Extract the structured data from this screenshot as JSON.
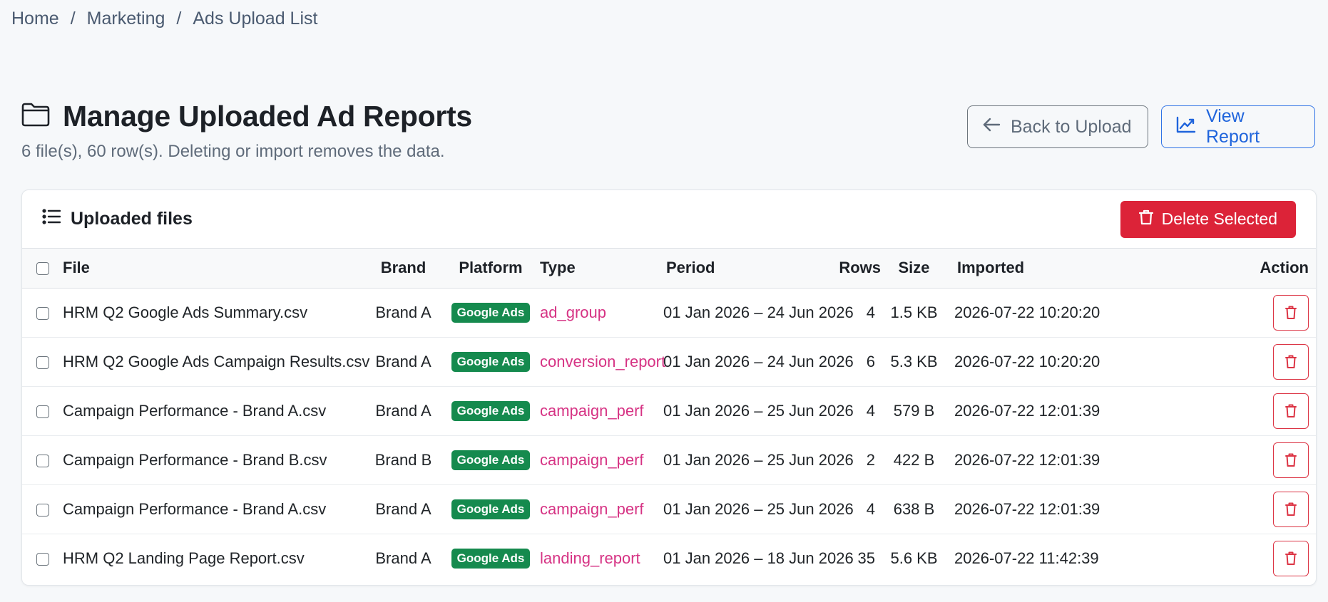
{
  "breadcrumb": {
    "items": [
      "Home",
      "Marketing",
      "Ads Upload List"
    ],
    "separator": "/"
  },
  "header": {
    "title": "Manage Uploaded Ad Reports",
    "subtitle": "6 file(s), 60 row(s). Deleting or import removes the data.",
    "icon": "folder-icon",
    "back_label": "Back to Upload",
    "view_label": "View Report"
  },
  "card": {
    "title": "Uploaded files",
    "delete_selected_label": "Delete Selected"
  },
  "table": {
    "columns": [
      "File",
      "Brand",
      "Platform",
      "Type",
      "Period",
      "Rows",
      "Size",
      "Imported",
      "Action"
    ],
    "rows": [
      {
        "file": "HRM Q2 Google Ads Summary.csv",
        "brand": "Brand A",
        "platform": "Google Ads",
        "type": "ad_group",
        "period": "01 Jan 2026 – 24 Jun 2026",
        "rows": "4",
        "size": "1.5 KB",
        "imported": "2026-07-22 10:20:20"
      },
      {
        "file": "HRM Q2 Google Ads Campaign Results.csv",
        "brand": "Brand A",
        "platform": "Google Ads",
        "type": "conversion_report",
        "period": "01 Jan 2026 – 24 Jun 2026",
        "rows": "6",
        "size": "5.3 KB",
        "imported": "2026-07-22 10:20:20"
      },
      {
        "file": "Campaign Performance - Brand A.csv",
        "brand": "Brand A",
        "platform": "Google Ads",
        "type": "campaign_perf",
        "period": "01 Jan 2026 – 25 Jun 2026",
        "rows": "4",
        "size": "579 B",
        "imported": "2026-07-22 12:01:39"
      },
      {
        "file": "Campaign Performance - Brand B.csv",
        "brand": "Brand B",
        "platform": "Google Ads",
        "type": "campaign_perf",
        "period": "01 Jan 2026 – 25 Jun 2026",
        "rows": "2",
        "size": "422 B",
        "imported": "2026-07-22 12:01:39"
      },
      {
        "file": "Campaign Performance - Brand A.csv",
        "brand": "Brand A",
        "platform": "Google Ads",
        "type": "campaign_perf",
        "period": "01 Jan 2026 – 25 Jun 2026",
        "rows": "4",
        "size": "638 B",
        "imported": "2026-07-22 12:01:39"
      },
      {
        "file": "HRM Q2 Landing Page Report.csv",
        "brand": "Brand A",
        "platform": "Google Ads",
        "type": "landing_report",
        "period": "01 Jan 2026 – 18 Jun 2026",
        "rows": "35",
        "size": "5.6 KB",
        "imported": "2026-07-22 11:42:39"
      }
    ]
  },
  "colors": {
    "primary": "#2f73e6",
    "danger": "#dc2338",
    "badge_green": "#158a4e",
    "type_pink": "#d63384"
  }
}
